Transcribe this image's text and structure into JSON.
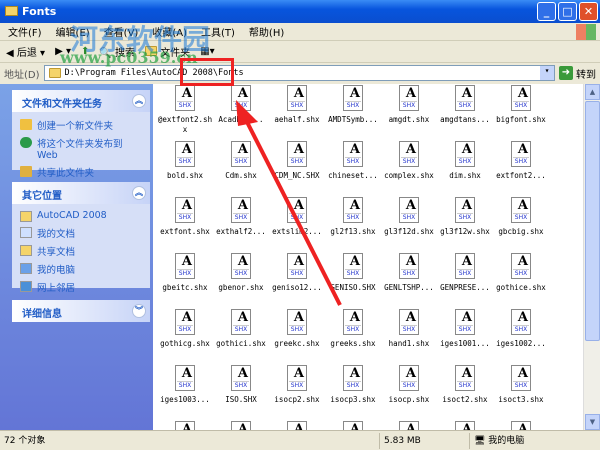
{
  "window": {
    "title": "Fonts"
  },
  "menu": [
    "文件(F)",
    "编辑(E)",
    "查看(V)",
    "收藏(A)",
    "工具(T)",
    "帮助(H)"
  ],
  "toolbar": {
    "back": "后退",
    "search": "搜索",
    "folders": "文件夹"
  },
  "address": {
    "label": "地址(D)",
    "path": "D:\\Program Files\\AutoCAD 2008\\Fonts",
    "go": "转到"
  },
  "tasks": {
    "title": "文件和文件夹任务",
    "items": [
      "创建一个新文件夹",
      "将这个文件夹发布到Web",
      "共享此文件夹"
    ]
  },
  "places": {
    "title": "其它位置",
    "items": [
      "AutoCAD 2008",
      "我的文档",
      "共享文档",
      "我的电脑",
      "网上邻居"
    ]
  },
  "details": {
    "title": "详细信息"
  },
  "file_badge": "SHX",
  "files": [
    "@extfont2.shx",
    "AcadRef...",
    "aehalf.shx",
    "AMDTSymb...",
    "amgdt.shx",
    "amgdtans...",
    "bigfont.shx",
    "bold.shx",
    "Cdm.shx",
    "CDM_NC.SHX",
    "chineset...",
    "complex.shx",
    "dim.shx",
    "extfont2...",
    "extfont.shx",
    "exthalf2...",
    "extslim2...",
    "gl2f13.shx",
    "gl3f12d.shx",
    "gl3f12w.shx",
    "gbcbig.shx",
    "gbeitc.shx",
    "gbenor.shx",
    "geniso12...",
    "GENISO.SHX",
    "GENLTSHP...",
    "GENPRESE...",
    "gothice.shx",
    "gothicg.shx",
    "gothici.shx",
    "greekc.shx",
    "greeks.shx",
    "hand1.shx",
    "iges1001...",
    "iges1002...",
    "iges1003...",
    "ISO.SHX",
    "isocp2.shx",
    "isocp3.shx",
    "isocp.shx",
    "isoct2.shx",
    "isoct3.shx",
    "",
    "",
    "",
    "",
    "",
    "",
    ""
  ],
  "status": {
    "count": "72 个对象",
    "size": "5.83 MB",
    "location": "我的电脑"
  },
  "watermark": {
    "name": "河东软件园",
    "url": "www.pc0359.cn"
  },
  "colors": {
    "annotation": "#ee2222",
    "title_bar": "#0855dd"
  }
}
